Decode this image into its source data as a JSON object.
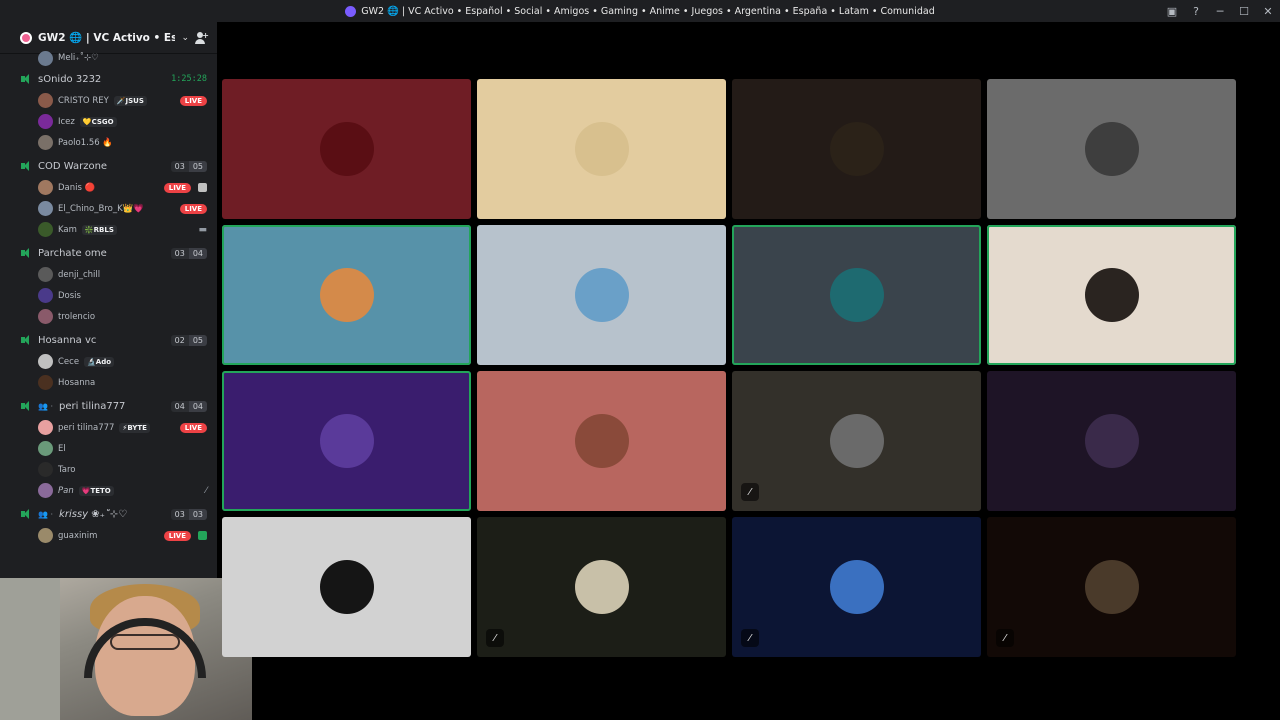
{
  "window": {
    "title": "GW2 🌐 | VC Activo • Español • Social • Amigos • Gaming • Anime • Juegos • Argentina • España • Latam • Comunidad",
    "controls": [
      "▣",
      "?",
      "─",
      "☐",
      "✕"
    ]
  },
  "server": {
    "name": "GW2 🌐 | VC Activo • Esp...",
    "chevron": "⌄"
  },
  "sidebar": {
    "top_member": {
      "name": "Meli₊˚⊹♡",
      "avatar": "#6b7a8f"
    },
    "channels": [
      {
        "name": "sOnido 3232",
        "timer": "1:25:28",
        "members": [
          {
            "name": "CRISTO REY",
            "tag": "🗡️JSUS",
            "live": "LIVE",
            "avatar": "#8a5a4a"
          },
          {
            "name": "Icez",
            "tag": "💛CSGO",
            "avatar": "#7a2a9a"
          },
          {
            "name": "Paolo1.56 🔥",
            "avatar": "#7a7068"
          }
        ]
      },
      {
        "name": "COD Warzone",
        "count": [
          "03",
          "05"
        ],
        "members": [
          {
            "name": "Danis 🔴",
            "live": "LIVE",
            "avatar": "#a07860"
          },
          {
            "name": "El_Chino_Bro_K👑💗",
            "live": "LIVE",
            "avatar": "#7a8aa0"
          },
          {
            "name": "Kam",
            "tag": "❇️RBLS",
            "avatar": "#3a5a2a"
          }
        ]
      },
      {
        "name": "Parchate ome",
        "count": [
          "03",
          "04"
        ],
        "members": [
          {
            "name": "denji_chill",
            "avatar": "#5a5a5a"
          },
          {
            "name": "Dosis",
            "avatar": "#4a3a8a"
          },
          {
            "name": "trolencio",
            "avatar": "#8a5a6a"
          }
        ]
      },
      {
        "name": "Hosanna vc",
        "count": [
          "02",
          "05"
        ],
        "members": [
          {
            "name": "Cece",
            "tag": "🔬Ado",
            "avatar": "#c0c0c0"
          },
          {
            "name": "Hosanna",
            "avatar": "#4a3020"
          }
        ]
      },
      {
        "name": "peri tilina777",
        "group": "👥 ·",
        "count": [
          "04",
          "04"
        ],
        "members": [
          {
            "name": "peri tilina777",
            "tag": "⚡BYTE",
            "live": "LIVE",
            "avatar": "#e8a0a0"
          },
          {
            "name": "El",
            "avatar": "#6a9a7a"
          },
          {
            "name": "Taro",
            "avatar": "#2a2a2a"
          },
          {
            "name": "Pan",
            "tag": "💗TETO",
            "avatar": "#8a6a9a",
            "muted": true
          }
        ]
      },
      {
        "name": "krissy ❀₊˚⊹♡",
        "group": "👥 ·",
        "count": [
          "03",
          "03"
        ],
        "members": [
          {
            "name": "guaxinim",
            "live": "LIVE",
            "avatar": "#9a8a6a"
          }
        ]
      }
    ]
  },
  "tiles": [
    {
      "bg": "#6f1d25",
      "avatar": "#5a0e14",
      "speaking": false,
      "muted": false
    },
    {
      "bg": "#e3cc9f",
      "avatar": "#d8c08e",
      "speaking": false,
      "muted": false
    },
    {
      "bg": "#231b17",
      "avatar": "#2b2218",
      "speaking": false,
      "muted": false
    },
    {
      "bg": "#6b6b6b",
      "avatar": "#3e3e3e",
      "speaking": false,
      "muted": false
    },
    {
      "bg": "#5792a9",
      "avatar": "#d48a4a",
      "speaking": true,
      "muted": false
    },
    {
      "bg": "#b7c2cc",
      "avatar": "#6aa0c8",
      "speaking": false,
      "muted": false
    },
    {
      "bg": "#3a444c",
      "avatar": "#1e6a70",
      "speaking": true,
      "muted": false
    },
    {
      "bg": "#e4dace",
      "avatar": "#2a2420",
      "speaking": true,
      "muted": false
    },
    {
      "bg": "#3a1d6e",
      "avatar": "#5a3a9a",
      "speaking": true,
      "muted": false
    },
    {
      "bg": "#b8665f",
      "avatar": "#8a4a3a",
      "speaking": false,
      "muted": false
    },
    {
      "bg": "#33302a",
      "avatar": "#6a6a6a",
      "speaking": false,
      "muted": true
    },
    {
      "bg": "#1e1426",
      "avatar": "#3a2a4a",
      "speaking": false,
      "muted": false
    },
    {
      "bg": "#d2d2d2",
      "avatar": "#151515",
      "speaking": false,
      "muted": false
    },
    {
      "bg": "#1c1e17",
      "avatar": "#c8c0a8",
      "speaking": false,
      "muted": true
    },
    {
      "bg": "#0c1534",
      "avatar": "#3a70c0",
      "speaking": false,
      "muted": true
    },
    {
      "bg": "#120906",
      "avatar": "#4a3a2a",
      "speaking": false,
      "muted": true
    }
  ],
  "icons": {
    "mute": "🎙̸",
    "speaker": "speaker-icon"
  }
}
